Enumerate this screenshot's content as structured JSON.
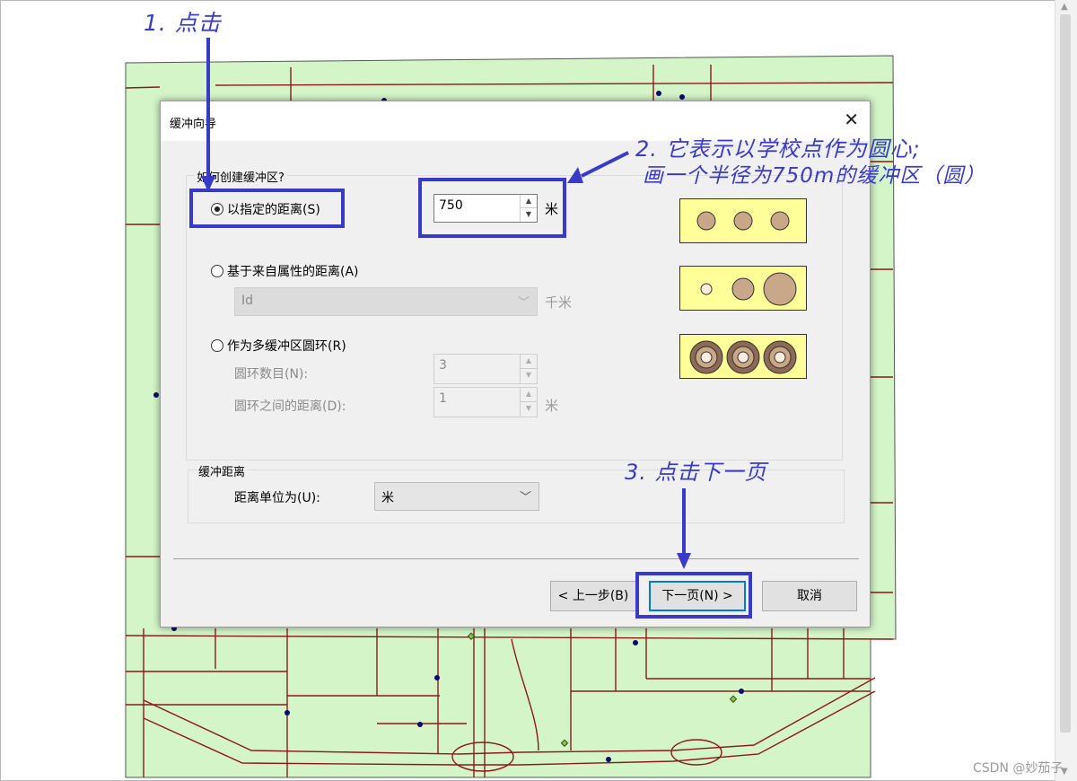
{
  "dialog": {
    "title": "缓冲向导",
    "close_glyph": "✕",
    "how_group_label": "如何创建缓冲区?",
    "option_distance": "以指定的距离(S)",
    "distance_value": "750",
    "distance_unit": "米",
    "option_attribute": "基于来自属性的距离(A)",
    "attribute_field": "Id",
    "attribute_unit": "千米",
    "option_rings": "作为多缓冲区圆环(R)",
    "ring_count_label": "圆环数目(N):",
    "ring_count_value": "3",
    "ring_distance_label": "圆环之间的距离(D):",
    "ring_distance_value": "1",
    "ring_distance_unit": "米",
    "buffer_group_label": "缓冲距离",
    "distance_unit_label": "距离单位为(U):",
    "distance_unit_value": "米",
    "back_button": "< 上一步(B)",
    "next_button": "下一页(N) >",
    "cancel_button": "取消"
  },
  "annotations": {
    "step1": "1. 点击",
    "step2_line1": "2. 它表示以学校点作为圆心;",
    "step2_line2": "画一个半径为750m的缓冲区（圆）",
    "step3": "3. 点击下一页"
  },
  "watermark": "CSDN @妙茄子",
  "colors": {
    "annotation": "#3a3ac8",
    "map_fill": "#d3f5c8",
    "road": "#8b1a1a",
    "preview_fill": "#ffff99",
    "buffer_fill": "#c9a88a",
    "buffer_dark": "#6b4a3a"
  }
}
